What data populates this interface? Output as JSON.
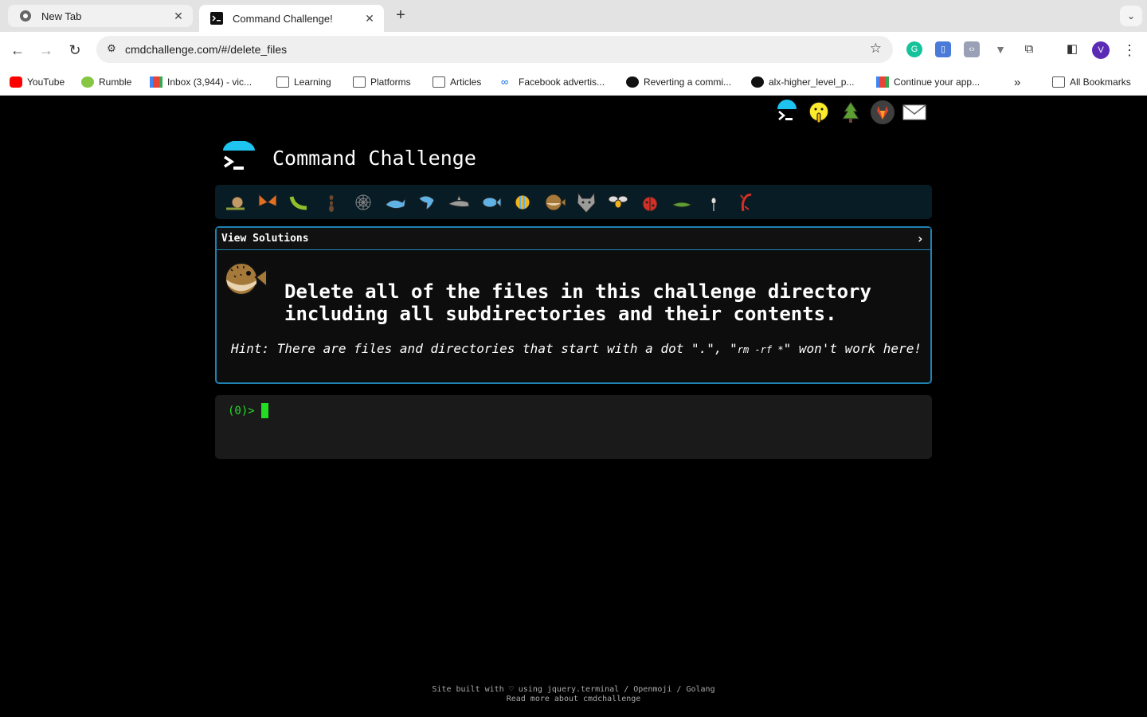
{
  "browser": {
    "tabs": [
      {
        "title": "New Tab",
        "active": false
      },
      {
        "title": "Command Challenge!",
        "active": true
      }
    ],
    "address": "cmdchallenge.com/#/delete_files",
    "avatar_letter": "V",
    "bookmarks": [
      {
        "label": "YouTube",
        "icon": "youtube-icon"
      },
      {
        "label": "Rumble",
        "icon": "rumble-icon"
      },
      {
        "label": "Inbox (3,944) - vic...",
        "icon": "gmail-icon"
      },
      {
        "label": "Learning",
        "icon": "folder-icon"
      },
      {
        "label": "Platforms",
        "icon": "folder-icon"
      },
      {
        "label": "Articles",
        "icon": "folder-icon"
      },
      {
        "label": "Facebook advertis...",
        "icon": "meta-icon"
      },
      {
        "label": "Reverting a commi...",
        "icon": "github-icon"
      },
      {
        "label": "alx-higher_level_p...",
        "icon": "github-icon"
      },
      {
        "label": "Continue your app...",
        "icon": "gmail-icon"
      }
    ],
    "all_bookmarks": "All Bookmarks"
  },
  "page": {
    "title": "Command Challenge",
    "solutions_label": "View Solutions",
    "solutions_chevron": "›",
    "task": "Delete all of the files in this challenge directory including all subdirectories and their contents.",
    "hint_prefix": "Hint: There are files and directories that start with a dot \".\", \"",
    "hint_code": "rm -rf *",
    "hint_suffix": "\" won't work here!",
    "prompt": "(0)>",
    "footer_line1": "Site built with ♡ using jquery.terminal / Openmoji / Golang",
    "footer_line2": "Read more about cmdchallenge"
  },
  "colors": {
    "accent": "#1f82b3",
    "terminal_green": "#22dd22",
    "logo_cyan": "#1ec3f0"
  }
}
